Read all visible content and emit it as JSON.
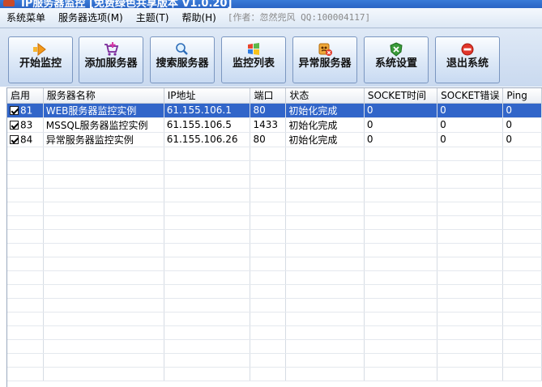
{
  "window": {
    "title": "IP服务器监控 [免费绿色共享版本 V1.0.20]"
  },
  "menu": {
    "items": [
      "系统菜单",
      "服务器选项(M)",
      "主题(T)",
      "帮助(H)"
    ],
    "author": "[作者：忽然兜风 QQ:100004117]"
  },
  "toolbar": {
    "buttons": [
      {
        "label": "开始监控",
        "icon": "arrow-right-icon"
      },
      {
        "label": "添加服务器",
        "icon": "cart-add-icon"
      },
      {
        "label": "搜索服务器",
        "icon": "magnifier-icon"
      },
      {
        "label": "监控列表",
        "icon": "windows-flag-icon"
      },
      {
        "label": "异常服务器",
        "icon": "warning-server-icon"
      },
      {
        "label": "系统设置",
        "icon": "settings-shield-icon"
      },
      {
        "label": "退出系统",
        "icon": "stop-icon"
      }
    ]
  },
  "grid": {
    "columns": [
      "启用",
      "服务器名称",
      "IP地址",
      "端口",
      "状态",
      "SOCKET时间",
      "SOCKET错误",
      "Ping"
    ],
    "rows": [
      {
        "enabled": true,
        "id": "81",
        "name": "WEB服务器监控实例",
        "ip": "61.155.106.1",
        "port": "80",
        "status": "初始化完成",
        "socket_time": "0",
        "socket_error": "0",
        "ping": "0",
        "selected": true
      },
      {
        "enabled": true,
        "id": "83",
        "name": "MSSQL服务器监控实例",
        "ip": "61.155.106.5",
        "port": "1433",
        "status": "初始化完成",
        "socket_time": "0",
        "socket_error": "0",
        "ping": "0",
        "selected": false
      },
      {
        "enabled": true,
        "id": "84",
        "name": "异常服务器监控实例",
        "ip": "61.155.106.26",
        "port": "80",
        "status": "初始化完成",
        "socket_time": "0",
        "socket_error": "0",
        "ping": "0",
        "selected": false
      }
    ]
  },
  "colors": {
    "selection": "#3165c9",
    "toolbar_bg": "#d3e1f3",
    "title_bg": "#2f6fd0"
  }
}
